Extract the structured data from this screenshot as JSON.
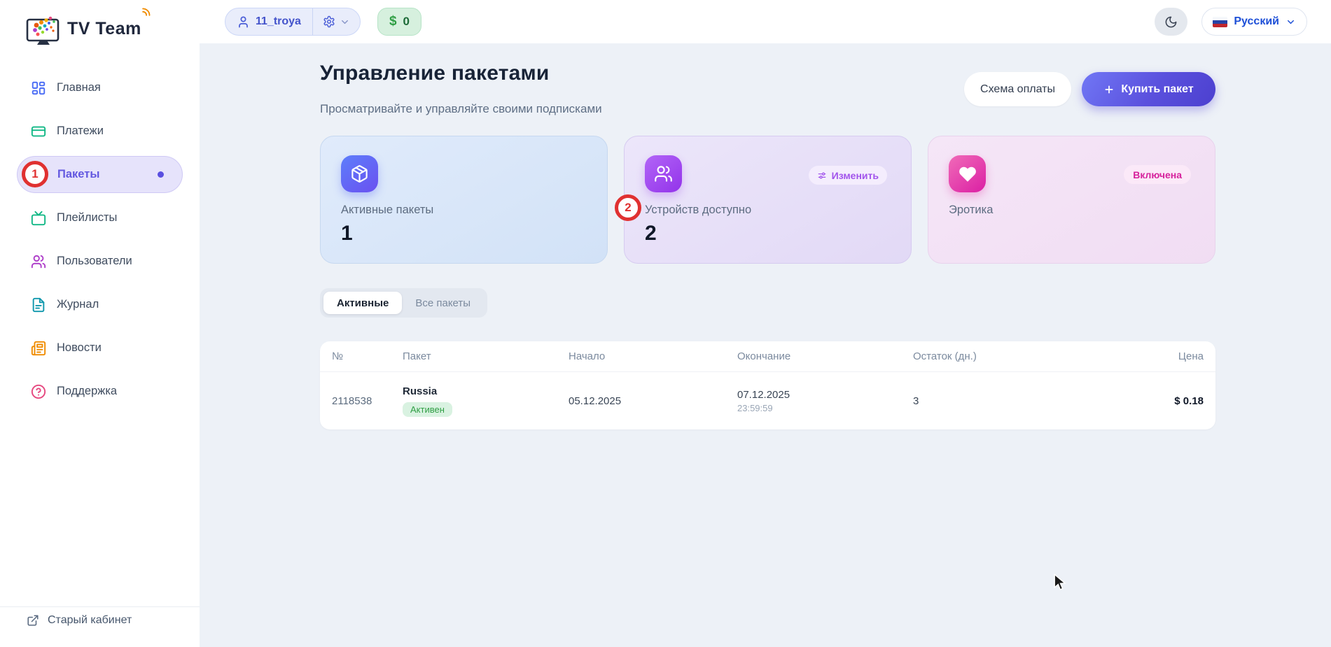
{
  "app": {
    "brand": "TV Team"
  },
  "topbar": {
    "user_name": "11_troya",
    "balance_currency": "$",
    "balance_amount": "0",
    "language": "Русский"
  },
  "sidebar": {
    "items": [
      {
        "label": "Главная"
      },
      {
        "label": "Платежи"
      },
      {
        "label": "Пакеты"
      },
      {
        "label": "Плейлисты"
      },
      {
        "label": "Пользователи"
      },
      {
        "label": "Журнал"
      },
      {
        "label": "Новости"
      },
      {
        "label": "Поддержка"
      }
    ],
    "footer_label": "Старый кабинет"
  },
  "page": {
    "title": "Управление пакетами",
    "subtitle": "Просматривайте и управляйте своими подписками",
    "secondary_action": "Схема оплаты",
    "primary_action": "Купить пакет"
  },
  "cards": [
    {
      "label": "Активные пакеты",
      "value": "1"
    },
    {
      "label": "Устройств доступно",
      "value": "2",
      "action": "Изменить"
    },
    {
      "label": "Эротика",
      "badge": "Включена"
    }
  ],
  "tabs": [
    {
      "label": "Активные"
    },
    {
      "label": "Все пакеты"
    }
  ],
  "table": {
    "headers": [
      "№",
      "Пакет",
      "Начало",
      "Окончание",
      "Остаток (дн.)",
      "Цена"
    ],
    "rows": [
      {
        "id": "2118538",
        "package": "Russia",
        "status": "Активен",
        "start": "05.12.2025",
        "end_date": "07.12.2025",
        "end_time": "23:59:59",
        "days_left": "3",
        "price": "$ 0.18"
      }
    ]
  },
  "annotations": {
    "circle1": "1",
    "circle2": "2"
  },
  "colors": {
    "accent_purple": "#5a4fe0",
    "active_pill_bg": "#e6e3fb",
    "balance_green": "#2f9e44",
    "status_green": "#2f9e44",
    "card_blue_icon": "#5d7efb",
    "card_purple_icon": "#9333ea",
    "card_pink_icon": "#db1fa4",
    "annotation_red": "#e03131",
    "link_blue": "#1d4fd7",
    "content_bg": "#edf1f7"
  }
}
